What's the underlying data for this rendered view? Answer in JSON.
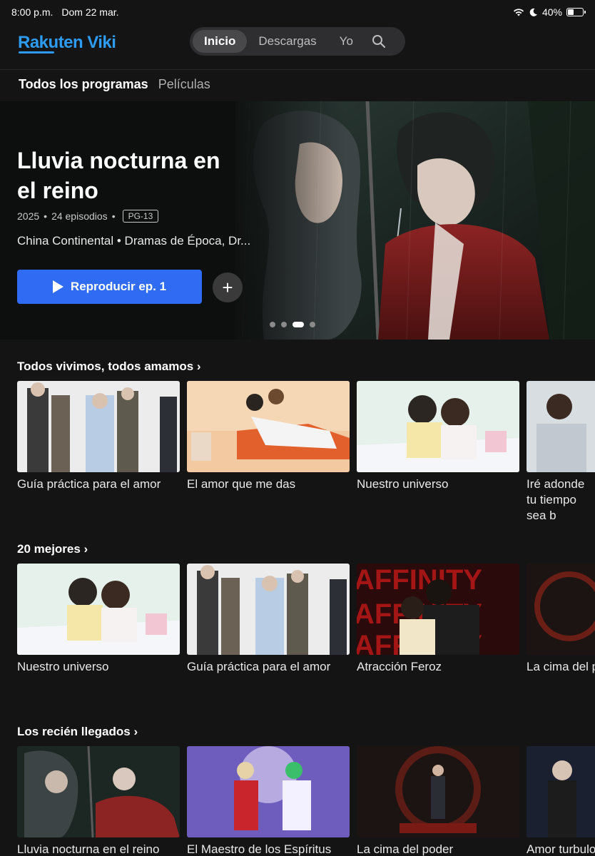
{
  "status_bar": {
    "time": "8:00 p.m.",
    "date": "Dom 22 mar.",
    "battery": "40%",
    "battery_level": 0.4
  },
  "nav": {
    "logo_rakuten": "Rakuten",
    "logo_viki": "Viki",
    "items": [
      "Inicio",
      "Descargas",
      "Yo"
    ],
    "active": "Inicio"
  },
  "tabs": [
    "Todos los programas",
    "Películas"
  ],
  "hero": {
    "title": "Lluvia nocturna en el reino",
    "year": "2025",
    "episodes": "24 episodios",
    "rating": "PG-13",
    "genres": "China Continental • Dramas de Época, Dr...",
    "play_label": "Reproducir ep. 1",
    "add_label": "+",
    "carousel_dots": 4,
    "carousel_active": 3
  },
  "rows": [
    {
      "title": "Todos vivimos, todos amamos ›",
      "items": [
        {
          "title": "Guía práctica para el amor"
        },
        {
          "title": "El amor que me das"
        },
        {
          "title": "Nuestro universo"
        },
        {
          "title": "Iré adonde tu tiempo sea b"
        }
      ]
    },
    {
      "title": "20 mejores ›",
      "items": [
        {
          "title": "Nuestro universo"
        },
        {
          "title": "Guía práctica para el amor"
        },
        {
          "title": "Atracción Feroz"
        },
        {
          "title": "La cima del p"
        }
      ]
    },
    {
      "title": "Los recién llegados ›",
      "items": [
        {
          "title": "Lluvia nocturna en el reino"
        },
        {
          "title": "El Maestro de los Espíritus"
        },
        {
          "title": "La cima del poder"
        },
        {
          "title": "Amor turbulo"
        }
      ]
    }
  ],
  "poster_text": {
    "affinity": "AFFINITY"
  },
  "colors": {
    "accent": "#2f6cf3",
    "logo": "#2d9bf0",
    "background": "#141414"
  }
}
